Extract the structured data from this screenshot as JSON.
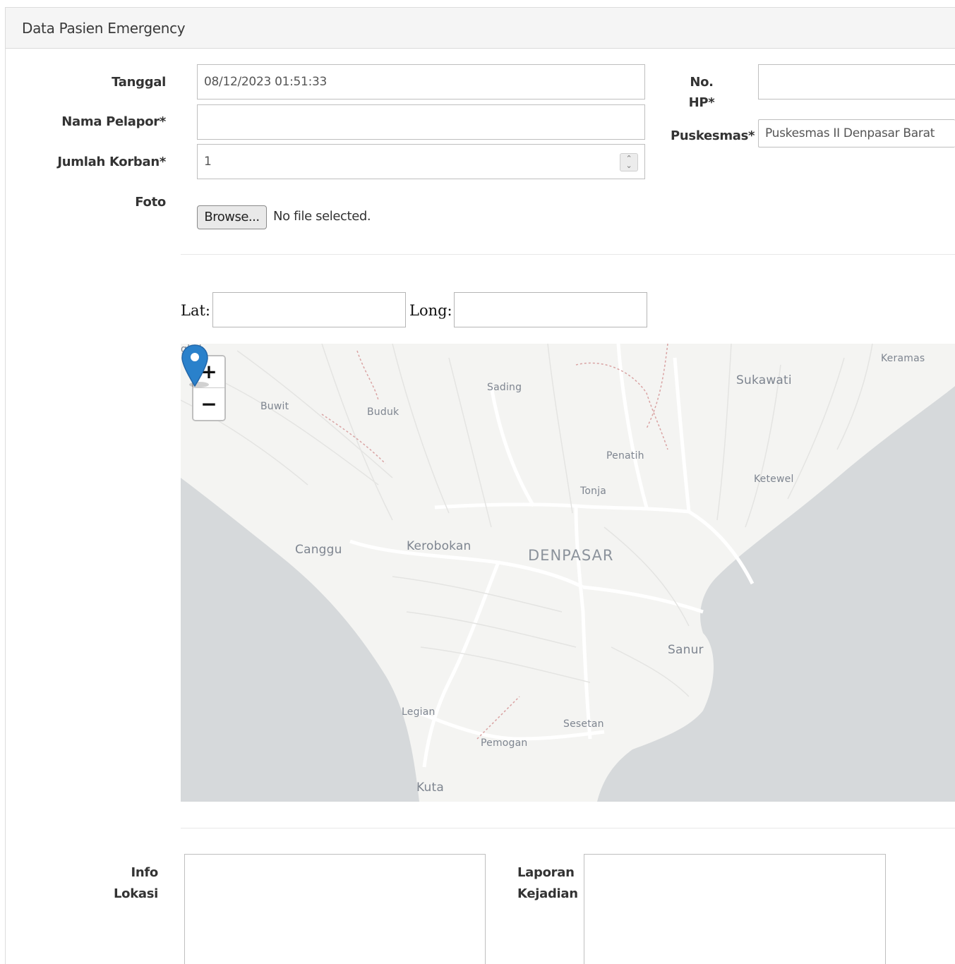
{
  "panel": {
    "title": "Data Pasien Emergency"
  },
  "form": {
    "tanggal": {
      "label": "Tanggal",
      "value": "08/12/2023 01:51:33"
    },
    "nama_pelapor": {
      "label": "Nama Pelapor*",
      "value": ""
    },
    "jumlah_korban": {
      "label": "Jumlah Korban*",
      "value": "1"
    },
    "foto": {
      "label": "Foto",
      "button": "Browse...",
      "status": "No file selected."
    },
    "no_hp": {
      "label_line1": "No.",
      "label_line2": "HP*",
      "value": ""
    },
    "puskesmas": {
      "label": "Puskesmas*",
      "selected": "Puskesmas II Denpasar Barat"
    }
  },
  "coords": {
    "lat_label": "Lat:",
    "lat_value": "",
    "long_label": "Long:",
    "long_value": ""
  },
  "map": {
    "zoom_in": "+",
    "zoom_out": "−",
    "places": [
      "gkel",
      "Sading",
      "Keramas",
      "Sukawati",
      "Buwit",
      "Buduk",
      "Penatih",
      "Ketewel",
      "Tonja",
      "Canggu",
      "Kerobokan",
      "DENPASAR",
      "Sanur",
      "Legian",
      "Sesetan",
      "Pemogan",
      "Kuta"
    ],
    "colors": {
      "land": "#f4f4f2",
      "water": "#d6d9db",
      "roads": "#ffffff",
      "marker": "#2a81cb"
    }
  },
  "bottom": {
    "info_lokasi": {
      "label_line1": "Info",
      "label_line2": "Lokasi",
      "value": ""
    },
    "laporan_kejadian": {
      "label_line1": "Laporan",
      "label_line2": "Kejadian",
      "value": ""
    }
  }
}
